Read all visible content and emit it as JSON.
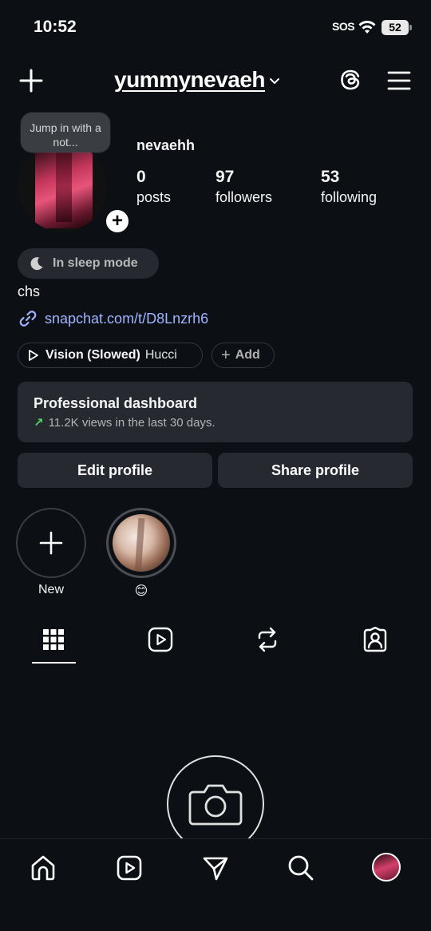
{
  "status_bar": {
    "time": "10:52",
    "sos": "SOS",
    "battery": "52"
  },
  "header": {
    "username": "yummynevaeh"
  },
  "profile": {
    "note": "Jump in with a not...",
    "display_name": "nevaehh",
    "stats": [
      {
        "value": "0",
        "label": "posts"
      },
      {
        "value": "97",
        "label": "followers"
      },
      {
        "value": "53",
        "label": "following"
      }
    ],
    "sleep_mode": "In sleep mode",
    "bio": "chs",
    "link": "snapchat.com/t/D8Lnzrh6",
    "music": {
      "title": "Vision (Slowed)",
      "artist": "Hucci"
    },
    "add_label": "Add"
  },
  "dashboard": {
    "title": "Professional dashboard",
    "subtitle": "11.2K views in the last 30 days."
  },
  "buttons": {
    "edit": "Edit profile",
    "share": "Share profile"
  },
  "highlights": [
    {
      "label": "New"
    },
    {
      "label": "😊"
    }
  ],
  "colors": {
    "background": "#0c1014",
    "surface": "#262a30",
    "link": "#a0b4ff",
    "trend": "#4cd964"
  }
}
